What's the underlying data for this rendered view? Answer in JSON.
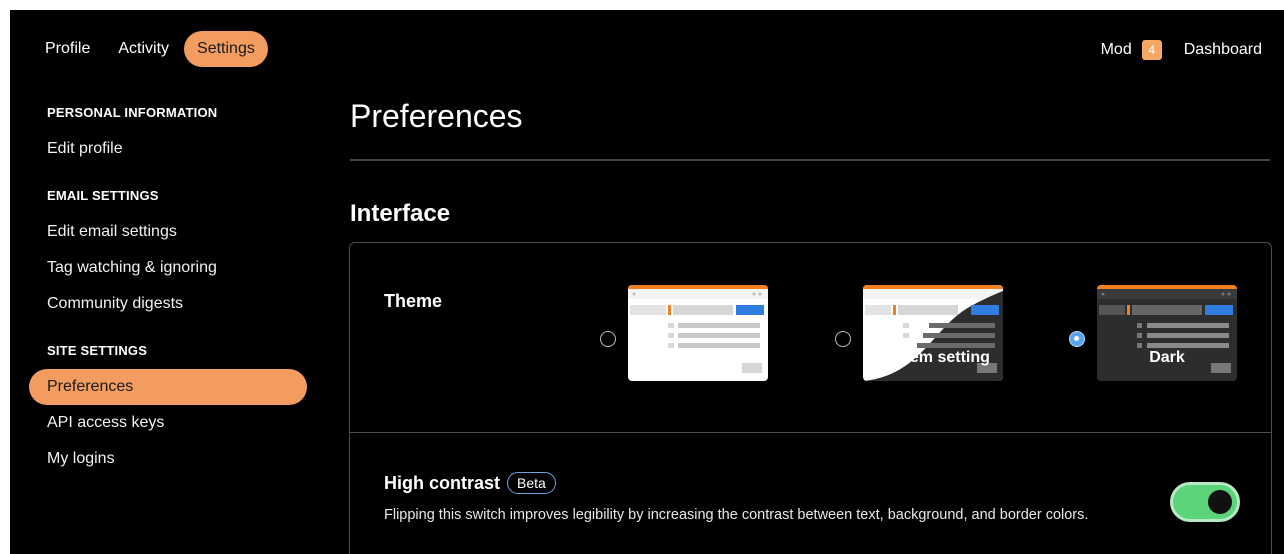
{
  "nav": {
    "tabs": [
      {
        "label": "Profile",
        "active": false
      },
      {
        "label": "Activity",
        "active": false
      },
      {
        "label": "Settings",
        "active": true
      }
    ],
    "mod_label": "Mod",
    "mod_count": "4",
    "dashboard_label": "Dashboard"
  },
  "sidebar": {
    "sections": [
      {
        "title": "PERSONAL INFORMATION",
        "items": [
          {
            "label": "Edit profile",
            "active": false
          }
        ]
      },
      {
        "title": "EMAIL SETTINGS",
        "items": [
          {
            "label": "Edit email settings",
            "active": false
          },
          {
            "label": "Tag watching & ignoring",
            "active": false
          },
          {
            "label": "Community digests",
            "active": false
          }
        ]
      },
      {
        "title": "SITE SETTINGS",
        "items": [
          {
            "label": "Preferences",
            "active": true
          },
          {
            "label": "API access keys",
            "active": false
          },
          {
            "label": "My logins",
            "active": false
          }
        ]
      }
    ]
  },
  "main": {
    "title": "Preferences",
    "section_title": "Interface",
    "theme": {
      "label": "Theme",
      "options": [
        {
          "label": "Light",
          "selected": false
        },
        {
          "label": "System setting",
          "selected": false
        },
        {
          "label": "Dark",
          "selected": true
        }
      ]
    },
    "high_contrast": {
      "title": "High contrast",
      "badge": "Beta",
      "description": "Flipping this switch improves legibility by increasing the contrast between text, background, and border colors.",
      "enabled": true
    }
  },
  "colors": {
    "accent": "#f29d5f",
    "toggle_on": "#5bd47a",
    "radio_selected": "#57a4f4",
    "beta_border": "#6ba3e0"
  }
}
